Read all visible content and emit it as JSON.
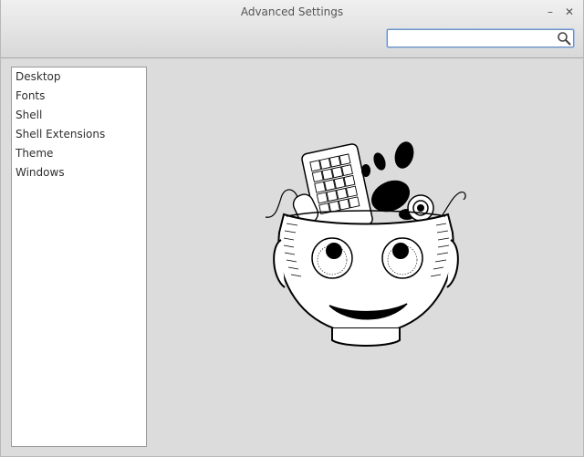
{
  "window": {
    "title": "Advanced Settings",
    "minimize_label": "–",
    "close_label": "✕"
  },
  "search": {
    "value": "",
    "placeholder": "",
    "icon": "search-icon"
  },
  "sidebar": {
    "items": [
      {
        "label": "Desktop"
      },
      {
        "label": "Fonts"
      },
      {
        "label": "Shell"
      },
      {
        "label": "Shell Extensions"
      },
      {
        "label": "Theme"
      },
      {
        "label": "Windows"
      }
    ]
  },
  "main": {
    "illustration": "tweak-tool-mascot"
  }
}
